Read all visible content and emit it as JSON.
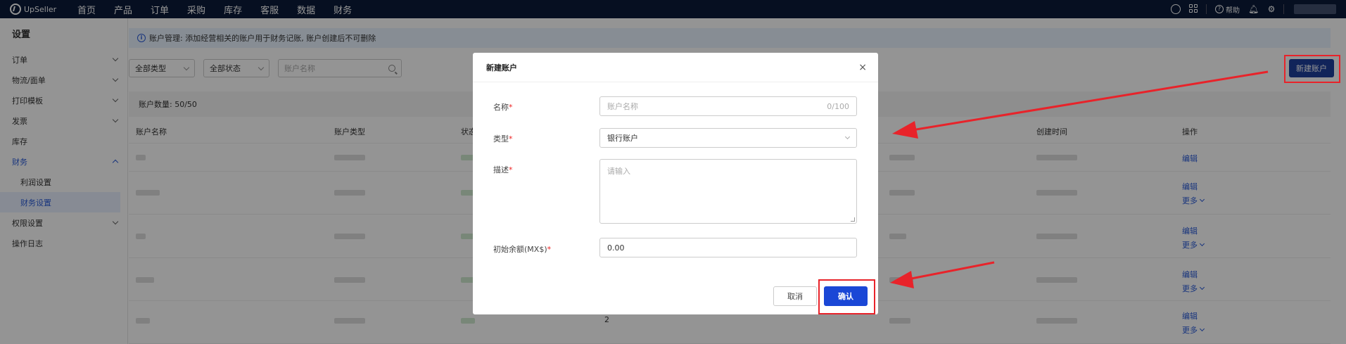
{
  "topbar": {
    "brand": "UpSeller",
    "nav": [
      "首页",
      "产品",
      "订单",
      "采购",
      "库存",
      "客服",
      "数据",
      "财务"
    ],
    "help_label": "帮助"
  },
  "sidebar": {
    "title": "设置",
    "items": [
      {
        "label": "订单"
      },
      {
        "label": "物流/面单"
      },
      {
        "label": "打印模板"
      },
      {
        "label": "发票"
      },
      {
        "label": "库存"
      },
      {
        "label": "财务"
      },
      {
        "label": "利润设置"
      },
      {
        "label": "财务设置"
      },
      {
        "label": "权限设置"
      },
      {
        "label": "操作日志"
      }
    ]
  },
  "main": {
    "notice": "账户管理: 添加经营相关的账户用于财务记账, 账户创建后不可删除",
    "filters": {
      "type_select": "全部类型",
      "status_select": "全部状态",
      "search_placeholder": "账户名称"
    },
    "new_account_button": "新建账户",
    "account_count": "账户数量: 50/50",
    "table": {
      "headers": {
        "name": "账户名称",
        "type": "账户类型",
        "status": "状态",
        "created": "创建时间",
        "ops": "操作"
      },
      "edit_label": "编辑",
      "more_label": "更多",
      "row5_col2": "2"
    }
  },
  "modal": {
    "title": "新建账户",
    "close_symbol": "×",
    "fields": {
      "name_label": "名称",
      "name_placeholder": "账户名称",
      "name_counter": "0/100",
      "type_label": "类型",
      "type_value": "银行账户",
      "desc_label": "描述",
      "desc_placeholder": "请输入",
      "balance_label": "初始余额(MX$)",
      "balance_value": "0.00",
      "required_mark": "*"
    },
    "cancel_button": "取消",
    "confirm_button": "确认"
  },
  "colors": {
    "topbar": "#0b1b3a",
    "primary": "#1a47d6",
    "annotation": "#e8232a"
  }
}
